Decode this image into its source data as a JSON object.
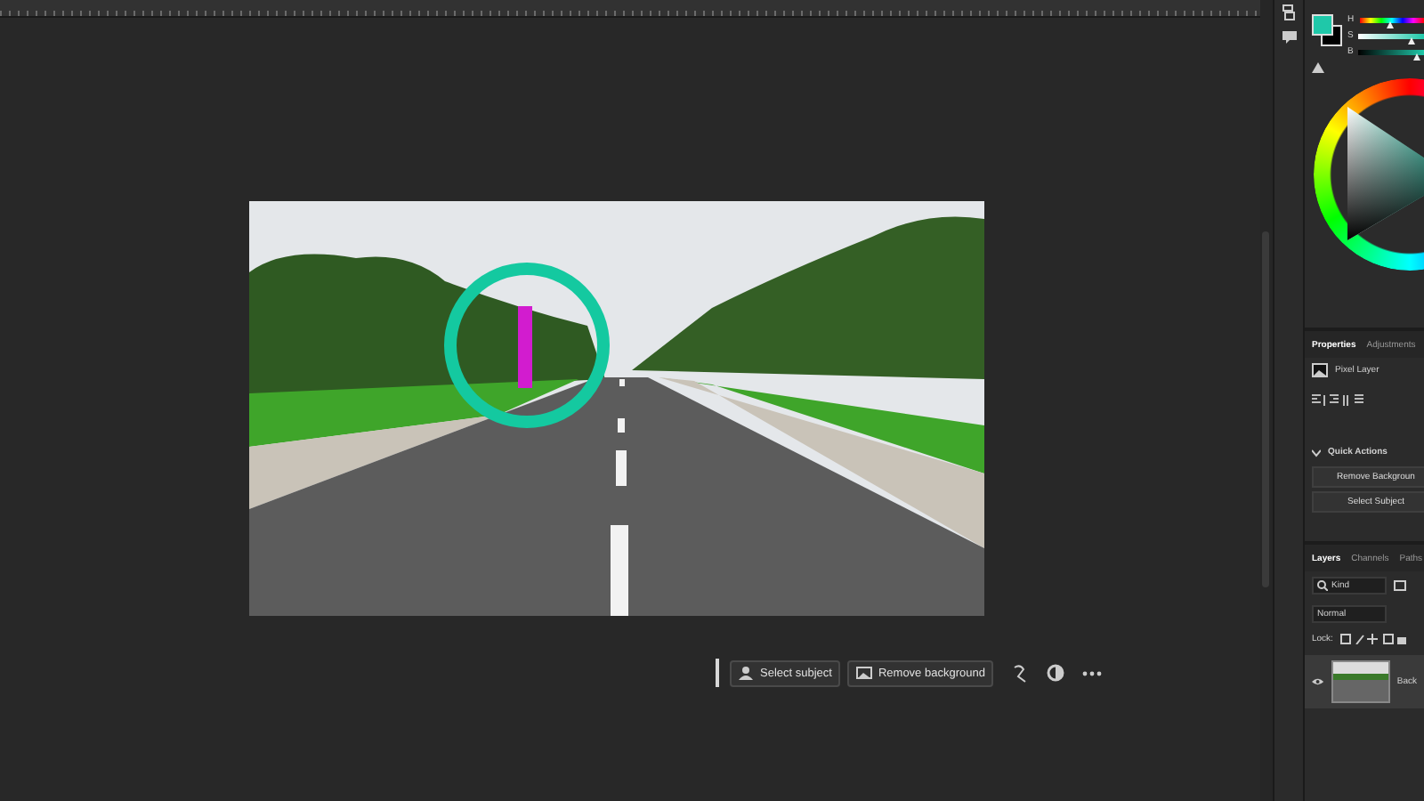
{
  "context_bar": {
    "buttons": [
      {
        "kind": "subject",
        "label": "Select subject"
      },
      {
        "kind": "background",
        "label": "Remove background"
      }
    ]
  },
  "color_panel": {
    "sliders": [
      {
        "label": "H",
        "level": 0.5
      },
      {
        "label": "S",
        "level": 0.82
      },
      {
        "label": "B",
        "level": 0.9
      }
    ]
  },
  "properties": {
    "tabs": [
      {
        "label": "Properties",
        "selected": true
      },
      {
        "label": "Adjustments",
        "selected": false
      }
    ],
    "layer_type": "Pixel Layer",
    "quick_actions": {
      "title": "Quick Actions",
      "expanded": true,
      "buttons": [
        "Remove Backgroun",
        "Select Subject"
      ]
    }
  },
  "layers": {
    "tabs": [
      {
        "label": "Layers",
        "selected": true
      },
      {
        "label": "Channels",
        "selected": false
      },
      {
        "label": "Paths",
        "selected": false
      }
    ],
    "filter": "Kind",
    "blend_mode": "Normal",
    "lock_label": "Lock:",
    "items": [
      {
        "name": "Back",
        "visible": true
      }
    ]
  }
}
